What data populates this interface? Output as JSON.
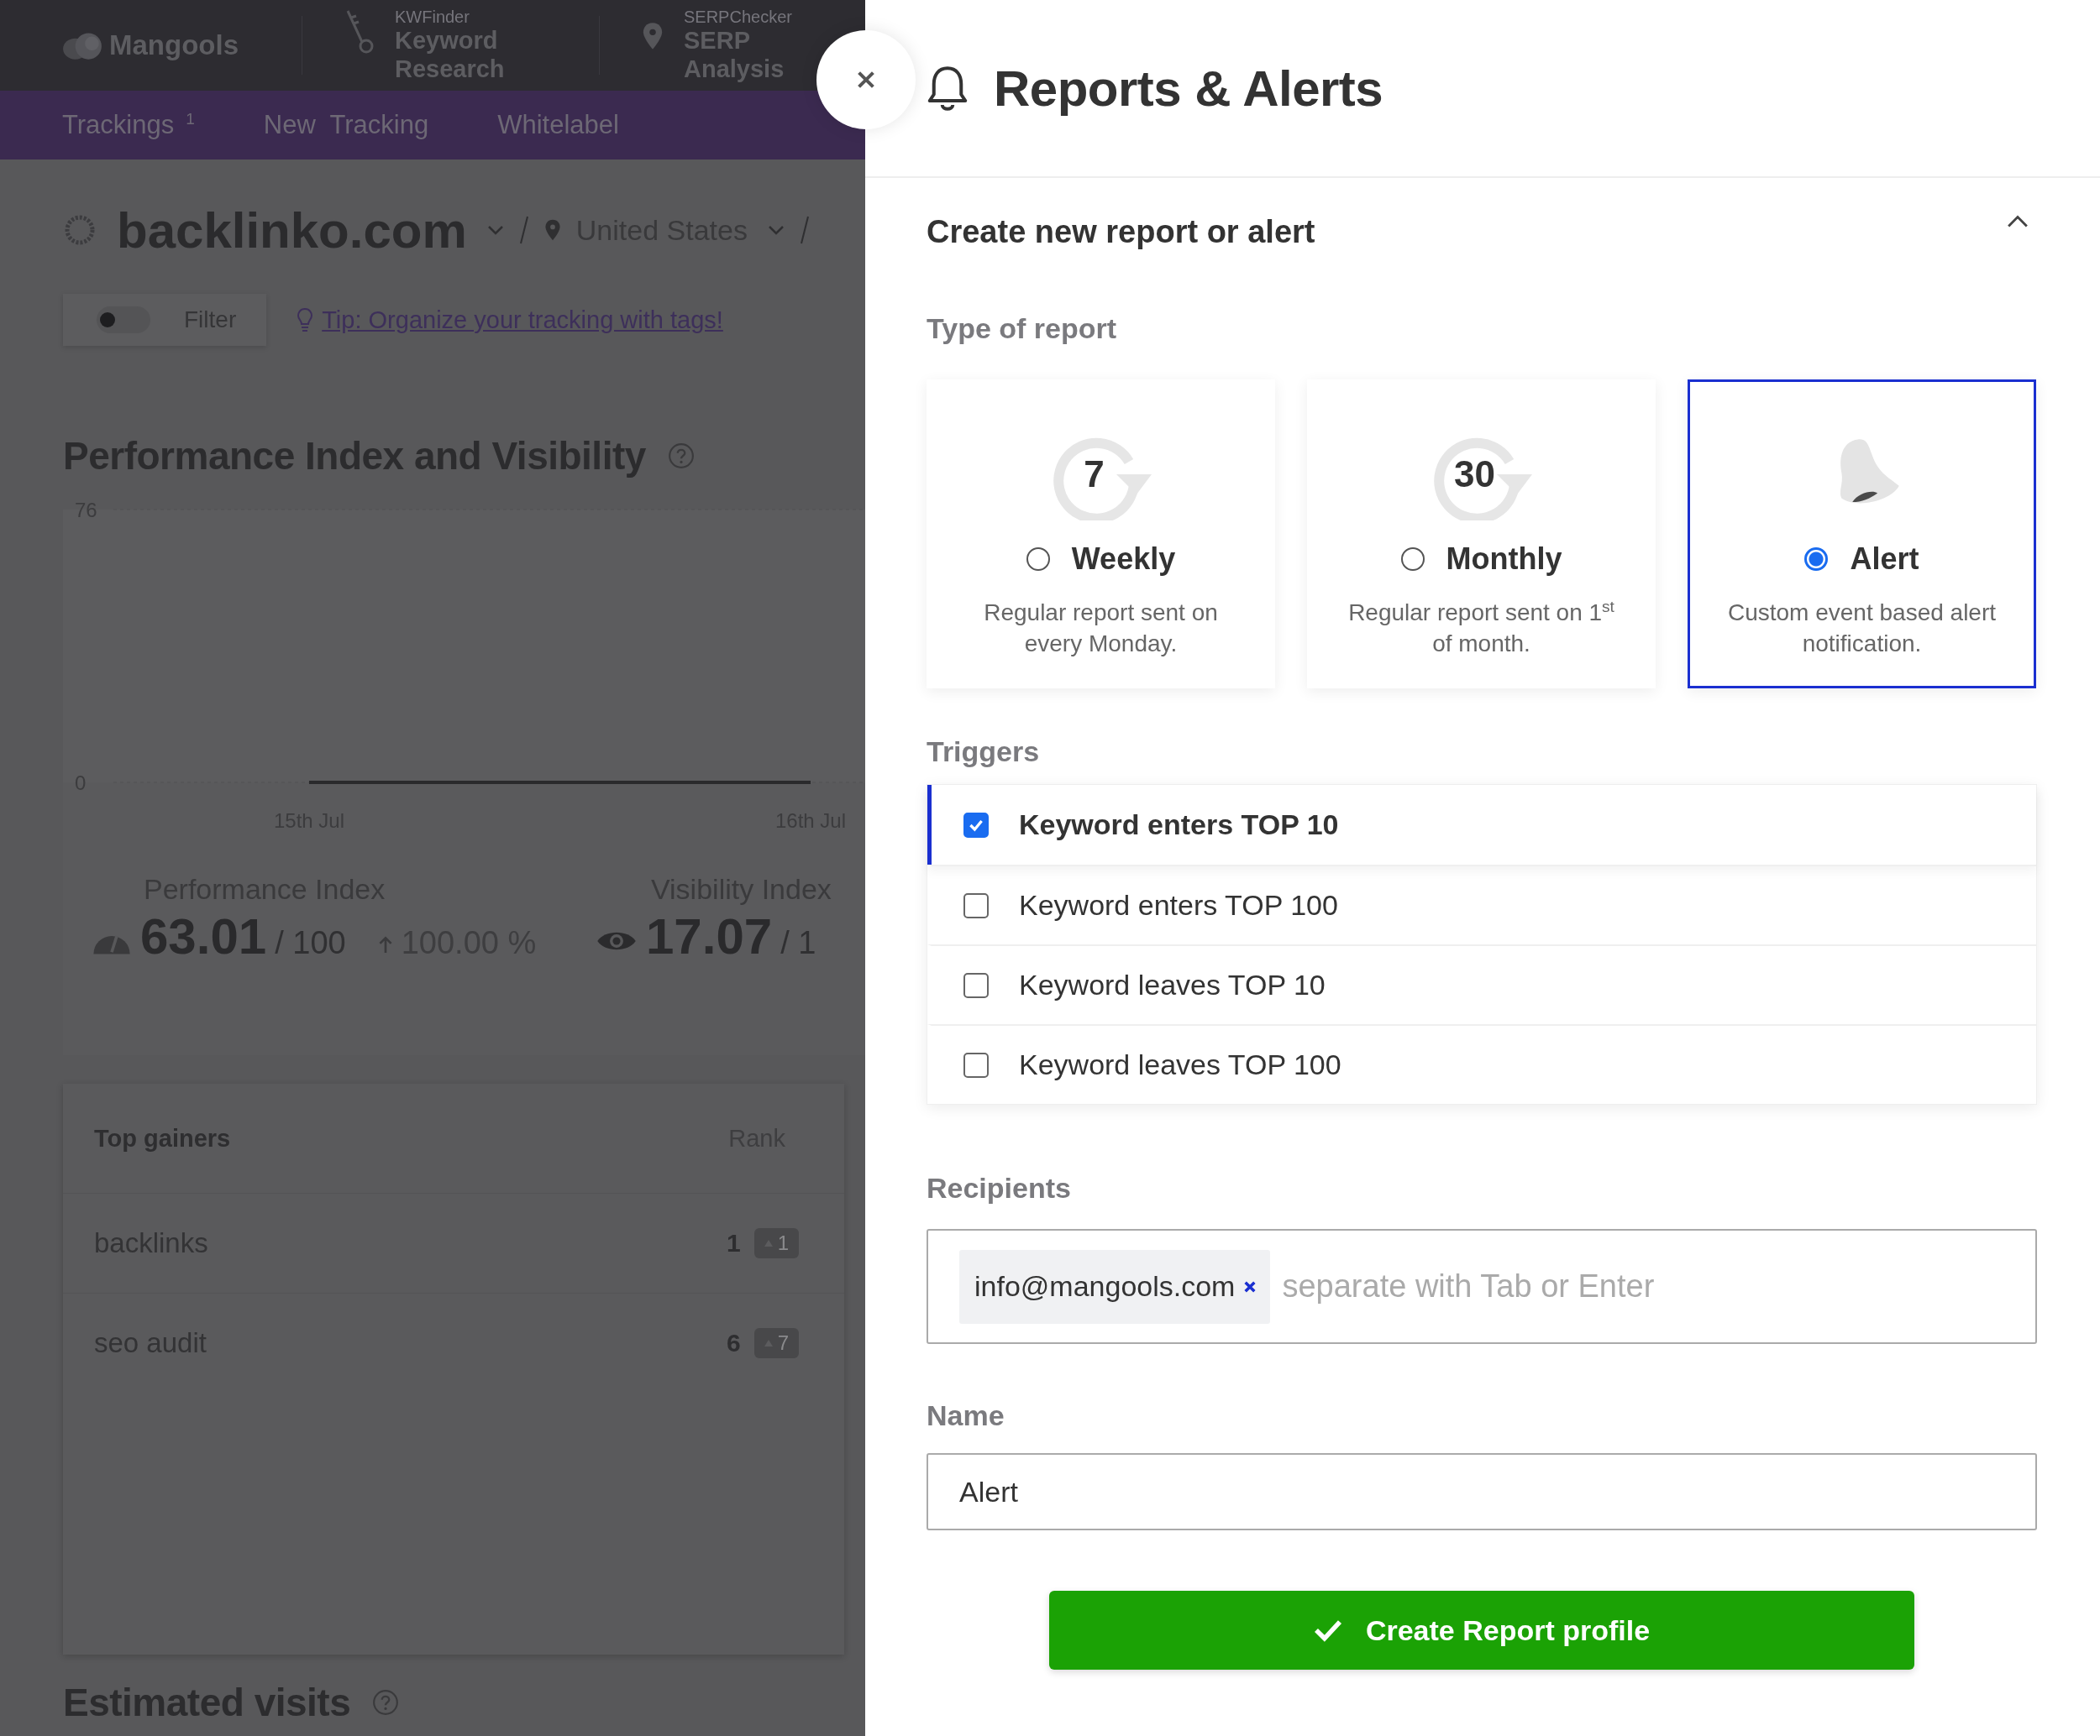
{
  "app_header": {
    "logo_text": "Mangools",
    "tools": [
      {
        "caption": "KWFinder",
        "title": "Keyword Research",
        "kind": "key"
      },
      {
        "caption": "SERPChecker",
        "title": "SERP Analysis",
        "kind": "pin"
      }
    ]
  },
  "nav": {
    "items": [
      {
        "label": "Trackings",
        "badge": "1"
      },
      {
        "label": "New  Tracking"
      },
      {
        "label": "Whitelabel"
      }
    ]
  },
  "tracking": {
    "domain": "backlinko.com",
    "location": "United States",
    "filter_on": false,
    "filter_label": "Filter",
    "tip": "Tip: Organize your tracking with tags!"
  },
  "performance": {
    "title": "Performance Index and Visibility",
    "chart_data": {
      "type": "line",
      "x": [
        "15th Jul",
        "16th Jul"
      ],
      "yticks": [
        0,
        76
      ],
      "ylim": [
        0,
        76
      ],
      "series": [
        {
          "color": "#2a2a2c",
          "values": [
            0,
            0
          ]
        }
      ]
    },
    "metrics": [
      {
        "kind": "performance",
        "label": "Performance Index",
        "value": "63.01",
        "max": "/ 100",
        "change": "100.00 %"
      },
      {
        "kind": "visibility",
        "label": "Visibility Index",
        "value": "17.07",
        "max": "/ 1"
      }
    ]
  },
  "top_gainers": {
    "columns": [
      "Top gainers",
      "Rank"
    ],
    "rows": [
      {
        "keyword": "backlinks",
        "rank": "1",
        "change": "1"
      },
      {
        "keyword": "seo audit",
        "rank": "6",
        "change": "7"
      }
    ]
  },
  "next_section": {
    "title": "Estimated visits"
  },
  "panel": {
    "title": "Reports & Alerts",
    "section_title": "Create new report or alert",
    "expanded": true,
    "type_label": "Type of report",
    "report_types": [
      {
        "kind": "weekly",
        "icon_text": "7",
        "name": "Weekly",
        "description": "Regular report sent on every Monday.",
        "selected": false
      },
      {
        "kind": "monthly",
        "icon_text": "30",
        "name": "Monthly",
        "description": "Regular report sent on 1$^{st}$ of month.",
        "selected": false
      },
      {
        "kind": "alert",
        "name": "Alert",
        "description": "Custom event based alert notification.",
        "selected": true
      }
    ],
    "triggers_label": "Triggers",
    "triggers": [
      {
        "label": "Keyword enters TOP 10",
        "checked": true
      },
      {
        "label": "Keyword enters TOP 100",
        "checked": false
      },
      {
        "label": "Keyword leaves TOP 10",
        "checked": false
      },
      {
        "label": "Keyword leaves TOP 100",
        "checked": false
      }
    ],
    "recipients_label": "Recipients",
    "recipients": [
      "info@mangools.com"
    ],
    "recipients_placeholder": "separate with Tab or Enter",
    "name_label": "Name",
    "name_value": "Alert",
    "submit": "Create Report profile"
  }
}
